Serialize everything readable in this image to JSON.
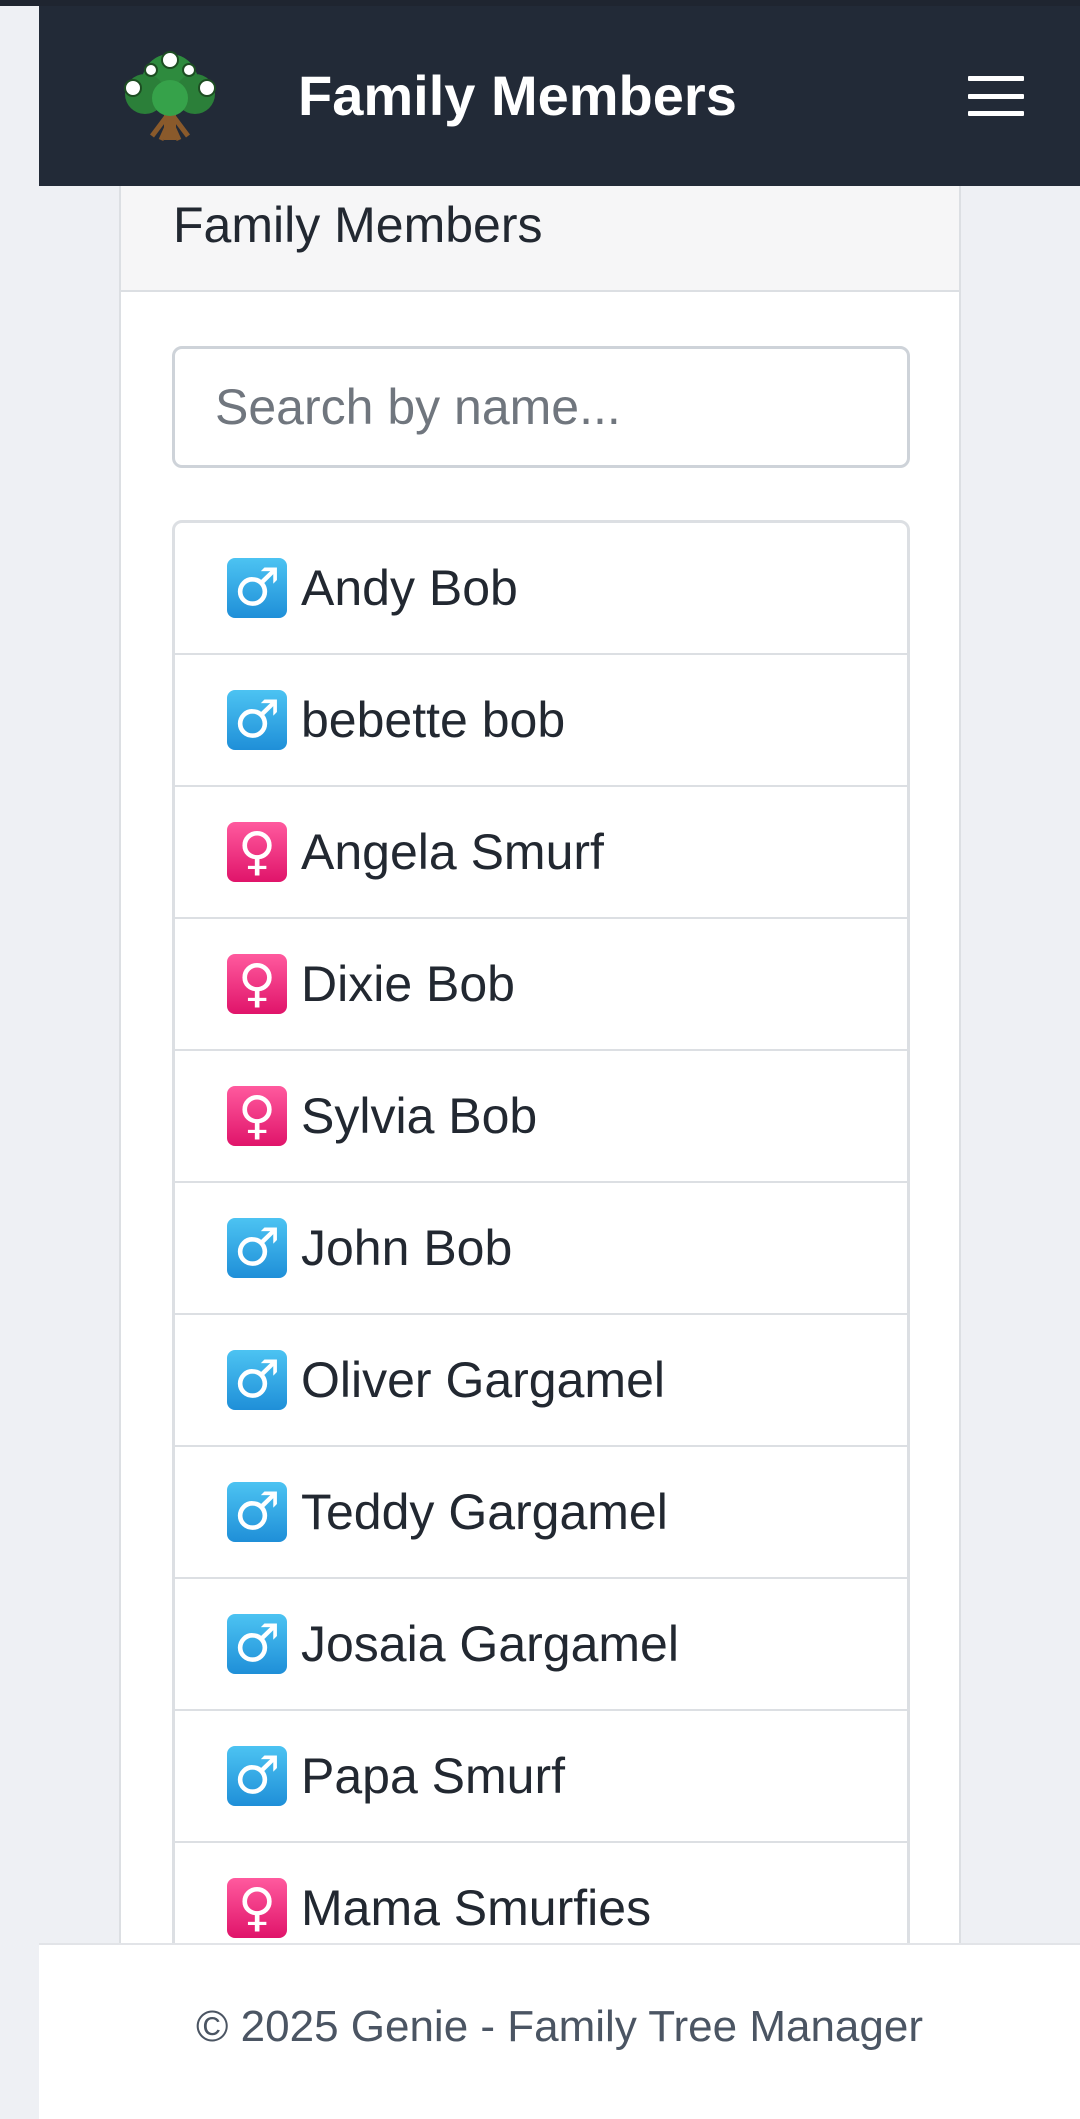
{
  "navbar": {
    "title": "Family Members",
    "menu_icon": "hamburger-menu-icon",
    "logo": "family-tree-logo"
  },
  "card": {
    "header": "Family Members"
  },
  "search": {
    "placeholder": "Search by name...",
    "value": ""
  },
  "members": [
    {
      "gender": "male",
      "icon": "male-sign-icon",
      "symbol": "♂",
      "name": "Andy Bob"
    },
    {
      "gender": "male",
      "icon": "male-sign-icon",
      "symbol": "♂",
      "name": "bebette bob"
    },
    {
      "gender": "female",
      "icon": "female-sign-icon",
      "symbol": "♀",
      "name": "Angela Smurf"
    },
    {
      "gender": "female",
      "icon": "female-sign-icon",
      "symbol": "♀",
      "name": "Dixie Bob"
    },
    {
      "gender": "female",
      "icon": "female-sign-icon",
      "symbol": "♀",
      "name": "Sylvia Bob"
    },
    {
      "gender": "male",
      "icon": "male-sign-icon",
      "symbol": "♂",
      "name": "John Bob"
    },
    {
      "gender": "male",
      "icon": "male-sign-icon",
      "symbol": "♂",
      "name": "Oliver Gargamel"
    },
    {
      "gender": "male",
      "icon": "male-sign-icon",
      "symbol": "♂",
      "name": "Teddy Gargamel"
    },
    {
      "gender": "male",
      "icon": "male-sign-icon",
      "symbol": "♂",
      "name": "Josaia Gargamel"
    },
    {
      "gender": "male",
      "icon": "male-sign-icon",
      "symbol": "♂",
      "name": "Papa Smurf"
    },
    {
      "gender": "female",
      "icon": "female-sign-icon",
      "symbol": "♀",
      "name": "Mama Smurfies"
    }
  ],
  "footer": {
    "text": "© 2025 Genie - Family Tree Manager"
  },
  "colors": {
    "navbar": "#222a37",
    "male": "#1f8fd8",
    "female": "#e0146a",
    "footer_text": "#4b5563"
  }
}
